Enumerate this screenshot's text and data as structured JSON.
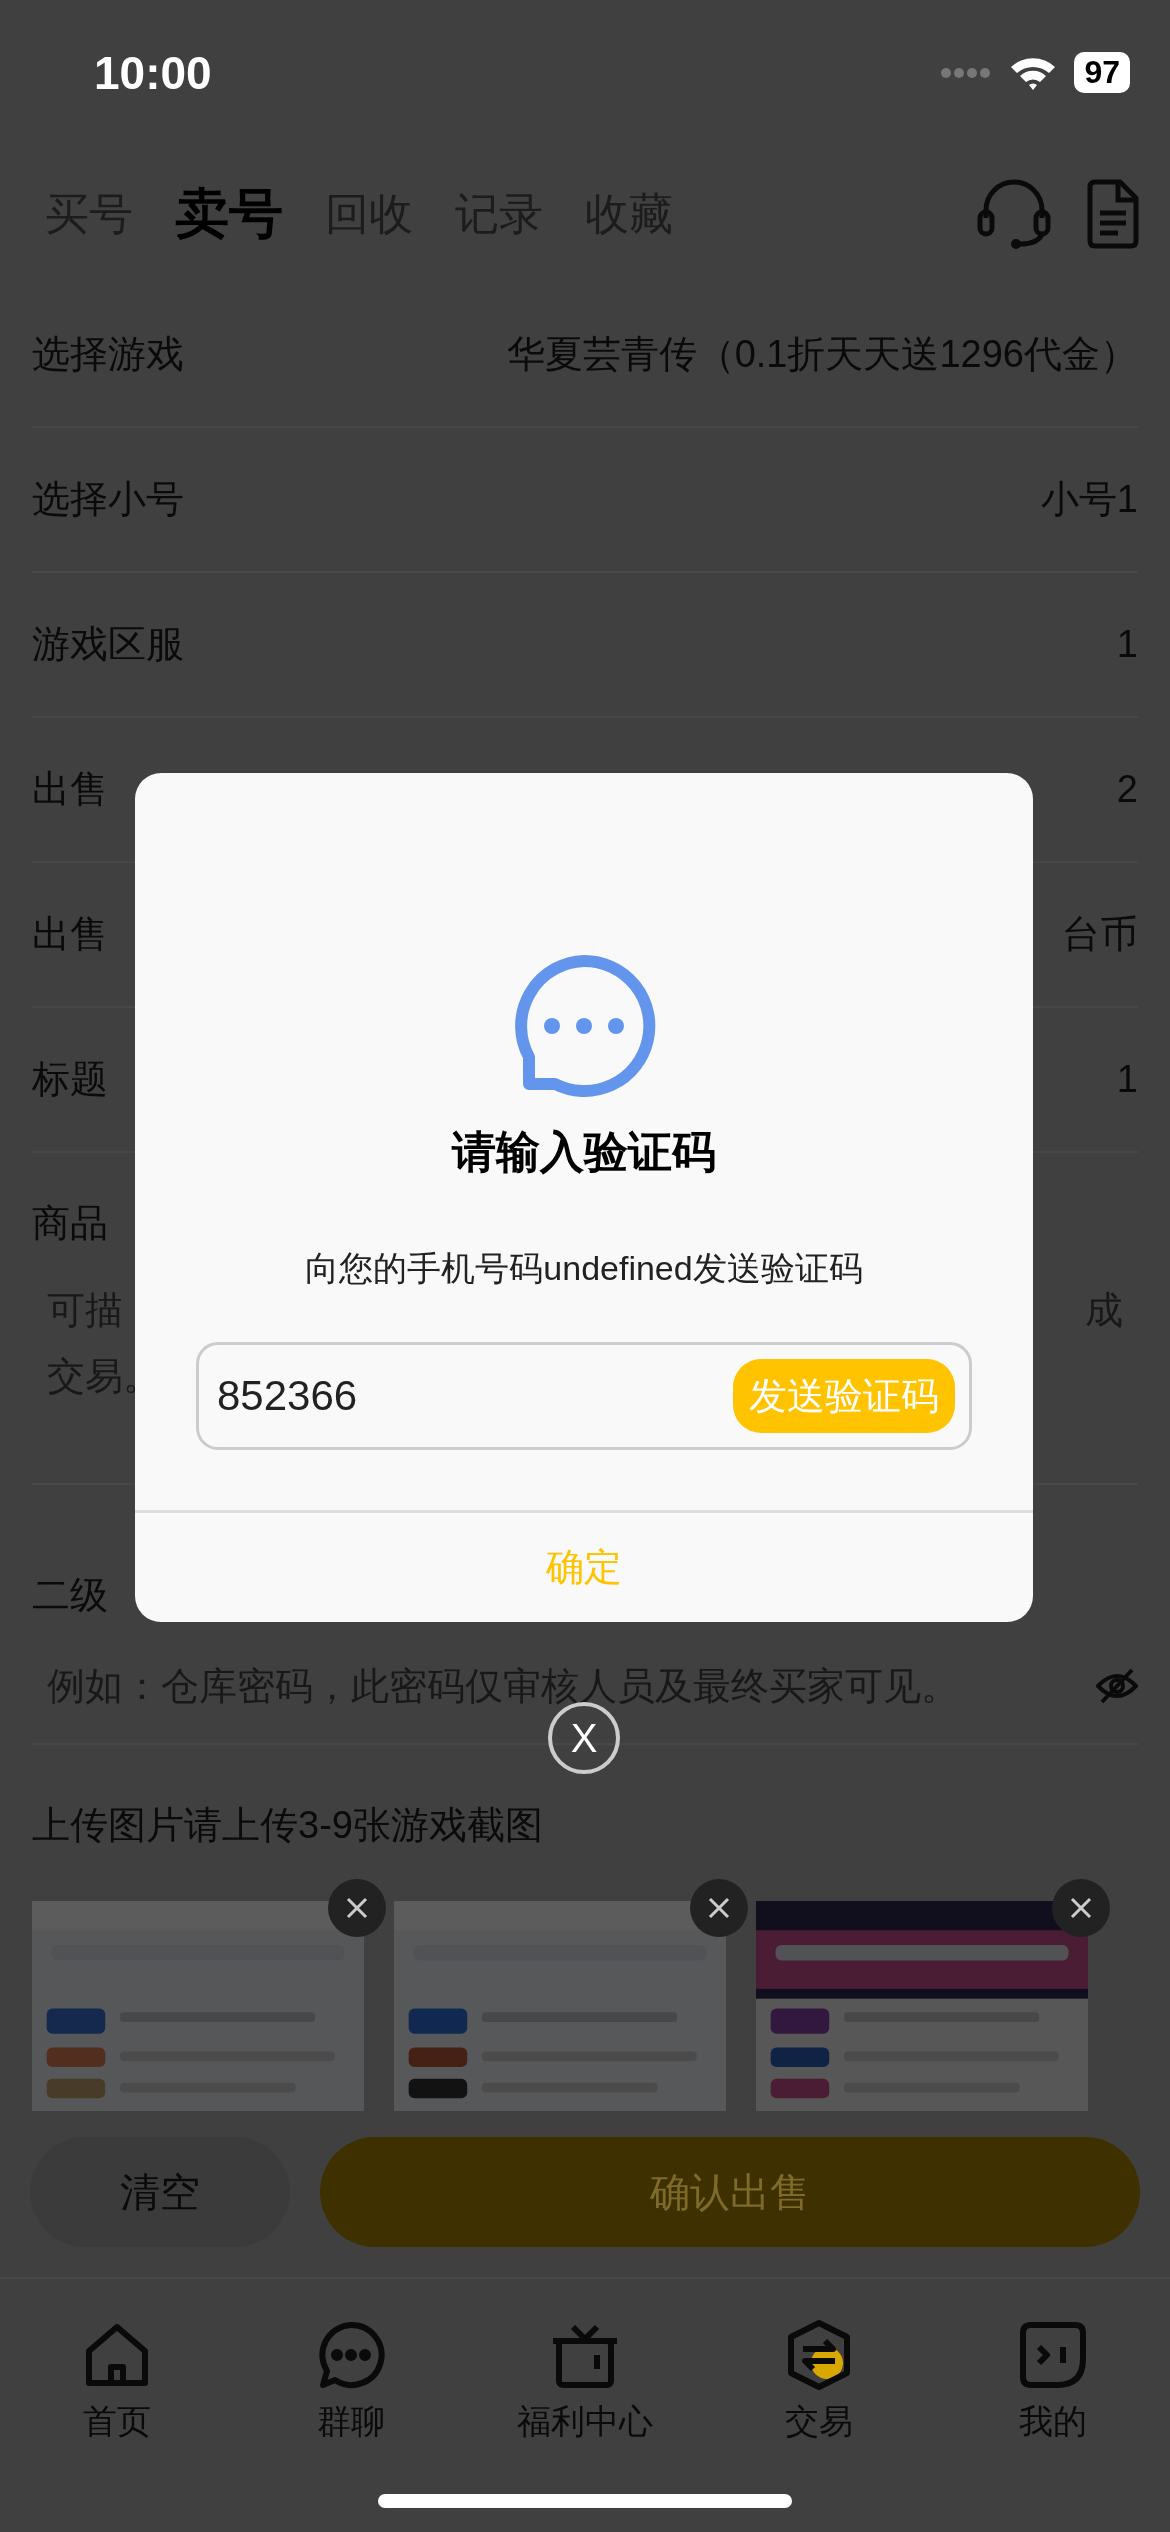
{
  "status_bar": {
    "time": "10:00",
    "battery": "97"
  },
  "tabs": [
    {
      "label": "买号",
      "selected": false
    },
    {
      "label": "卖号",
      "selected": true
    },
    {
      "label": "回收",
      "selected": false
    },
    {
      "label": "记录",
      "selected": false
    },
    {
      "label": "收藏",
      "selected": false
    }
  ],
  "form": {
    "rows": [
      {
        "label": "选择游戏",
        "value": "华夏芸青传（0.1折天天送1296代金）"
      },
      {
        "label": "选择小号",
        "value": "小号1"
      },
      {
        "label": "游戏区服",
        "value": "1"
      },
      {
        "label": "出售",
        "value": "2"
      },
      {
        "label": "出售",
        "value": "台币"
      },
      {
        "label": "标题",
        "value": "1"
      }
    ],
    "description": {
      "label": "商品",
      "placeholder_left": [
        "可描",
        "交易。"
      ],
      "placeholder_right": "成"
    },
    "password": {
      "label": "二级",
      "placeholder": "例如：仓库密码，此密码仅审核人员及最终买家可见。"
    },
    "upload": {
      "title": "上传图片请上传3-9张游戏截图"
    }
  },
  "actions": {
    "clear": "清空",
    "confirm": "确认出售"
  },
  "bottom_nav": [
    {
      "label": "首页",
      "selected": false
    },
    {
      "label": "群聊",
      "selected": false
    },
    {
      "label": "福利中心",
      "selected": false
    },
    {
      "label": "交易",
      "selected": true
    },
    {
      "label": "我的",
      "selected": false
    }
  ],
  "modal": {
    "title": "请输入验证码",
    "message": "向您的手机号码undefined发送验证码",
    "code": "852366",
    "send_button": "发送验证码",
    "confirm": "确定",
    "close": "X"
  }
}
